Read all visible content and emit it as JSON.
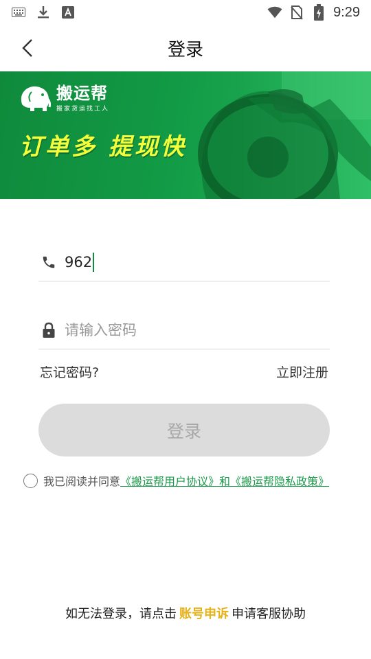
{
  "status_bar": {
    "time": "9:29",
    "icons": [
      "keyboard-icon",
      "download-icon",
      "a-letter-icon",
      "wifi-icon",
      "no-sim-icon",
      "battery-charging-icon"
    ]
  },
  "header": {
    "title": "登录"
  },
  "banner": {
    "brand_name": "搬运帮",
    "brand_slogan": "搬家货运找工人",
    "headline": "订单多 提现快"
  },
  "form": {
    "phone_value": "962",
    "password_placeholder": "请输入密码",
    "forgot_password": "忘记密码?",
    "register": "立即注册",
    "login_button": "登录"
  },
  "agreement": {
    "prefix": "我已阅读并同意",
    "link_text": "《搬运帮用户协议》和《搬运帮隐私政策》"
  },
  "help": {
    "prefix": "如无法登录，请点击",
    "link": "账号申诉",
    "suffix": "申请客服协助"
  },
  "colors": {
    "brand_green": "#129a45",
    "headline_yellow": "#f3ff3a",
    "link_green": "#1a9a4a",
    "appeal_gold": "#e7b118",
    "button_disabled": "#dcdcdc"
  }
}
